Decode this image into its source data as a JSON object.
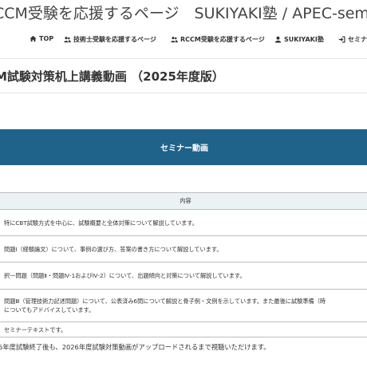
{
  "header": {
    "site_title": "CCM受験を応援するページ　SUKIYAKI塾 / APEC-sem"
  },
  "nav": {
    "items": [
      {
        "label": "TOP",
        "icon": "home-icon"
      },
      {
        "label": "技術士受験を応援するページ",
        "icon": "users-icon"
      },
      {
        "label": "RCCM受験を応援するページ",
        "icon": "users-icon"
      },
      {
        "label": "SUKIYAKI塾",
        "icon": "user-icon"
      },
      {
        "label": "セミナ",
        "icon": "signin-icon"
      }
    ]
  },
  "page": {
    "title": "M試験対策机上講義動画 （2025年度版）"
  },
  "banner": {
    "label": "セミナー動画"
  },
  "table": {
    "header": "内容",
    "rows": [
      "特にCBT試験方式を中心に、試験概要と全体対策について解説しています。",
      "問題Ⅰ（経験論文）について、事例の選び方、答案の書き方について解説しています。",
      "択一問題（問題Ⅱ・問題Ⅳ-1およびⅣ-2）について、出題傾向と対策について解説しています。",
      "問題Ⅲ（管理技術力記述問題）について、公表済み6問について解説と骨子例・文例を示しています。また最後に試験準備（時",
      "についてもアドバイスしています。",
      "セミナーテキストです。"
    ]
  },
  "note": {
    "text": "5年度試験終了後も、2026年度試験対策動画がアップロードされるまで視聴いただけます。"
  },
  "colors": {
    "banner_bg": "#1f628a",
    "table_header_bg": "#eaf2f4"
  }
}
